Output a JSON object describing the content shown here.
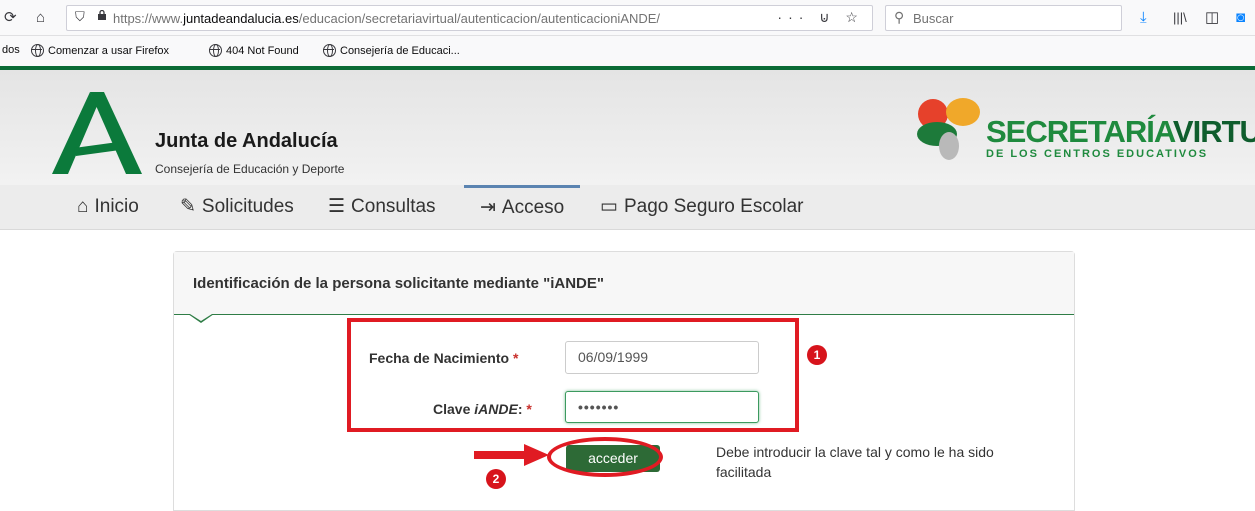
{
  "browser": {
    "url_prefix": "https://www.",
    "url_domain": "juntadeandalucia.es",
    "url_path": "/educacion/secretariavirtual/autenticacion/autenticacioniANDE/",
    "url_actions": "··· ⊍ ☆",
    "search_placeholder": "Buscar"
  },
  "bookmarks": {
    "left_fragment": "dos",
    "items": [
      "Comenzar a usar Firefox",
      "404 Not Found",
      "Consejería de Educaci..."
    ]
  },
  "header": {
    "org_title": "Junta de Andalucía",
    "org_subtitle": "Consejería de Educación y Deporte",
    "sv_title_a": "SECRETARÍA",
    "sv_title_b": "VIRTUAL",
    "sv_subtitle": "DE LOS CENTROS EDUCATIVOS"
  },
  "nav": {
    "items": [
      "Inicio",
      "Solicitudes",
      "Consultas",
      "Acceso",
      "Pago Seguro Escolar"
    ],
    "active": "Acceso"
  },
  "form": {
    "panel_title": "Identificación de la persona solicitante mediante \"iANDE\"",
    "birth_label": "Fecha de Nacimiento",
    "key_label_a": "Clave ",
    "key_label_b": "iANDE",
    "key_label_c": ":",
    "required_mark": "*",
    "birth_value": "06/09/1999",
    "key_value": "•••••••",
    "submit_label": "acceder",
    "hint": "Debe introducir la clave tal y como le ha sido facilitada"
  },
  "annotations": {
    "badge1": "1",
    "badge2": "2",
    "color": "#e01b23"
  }
}
